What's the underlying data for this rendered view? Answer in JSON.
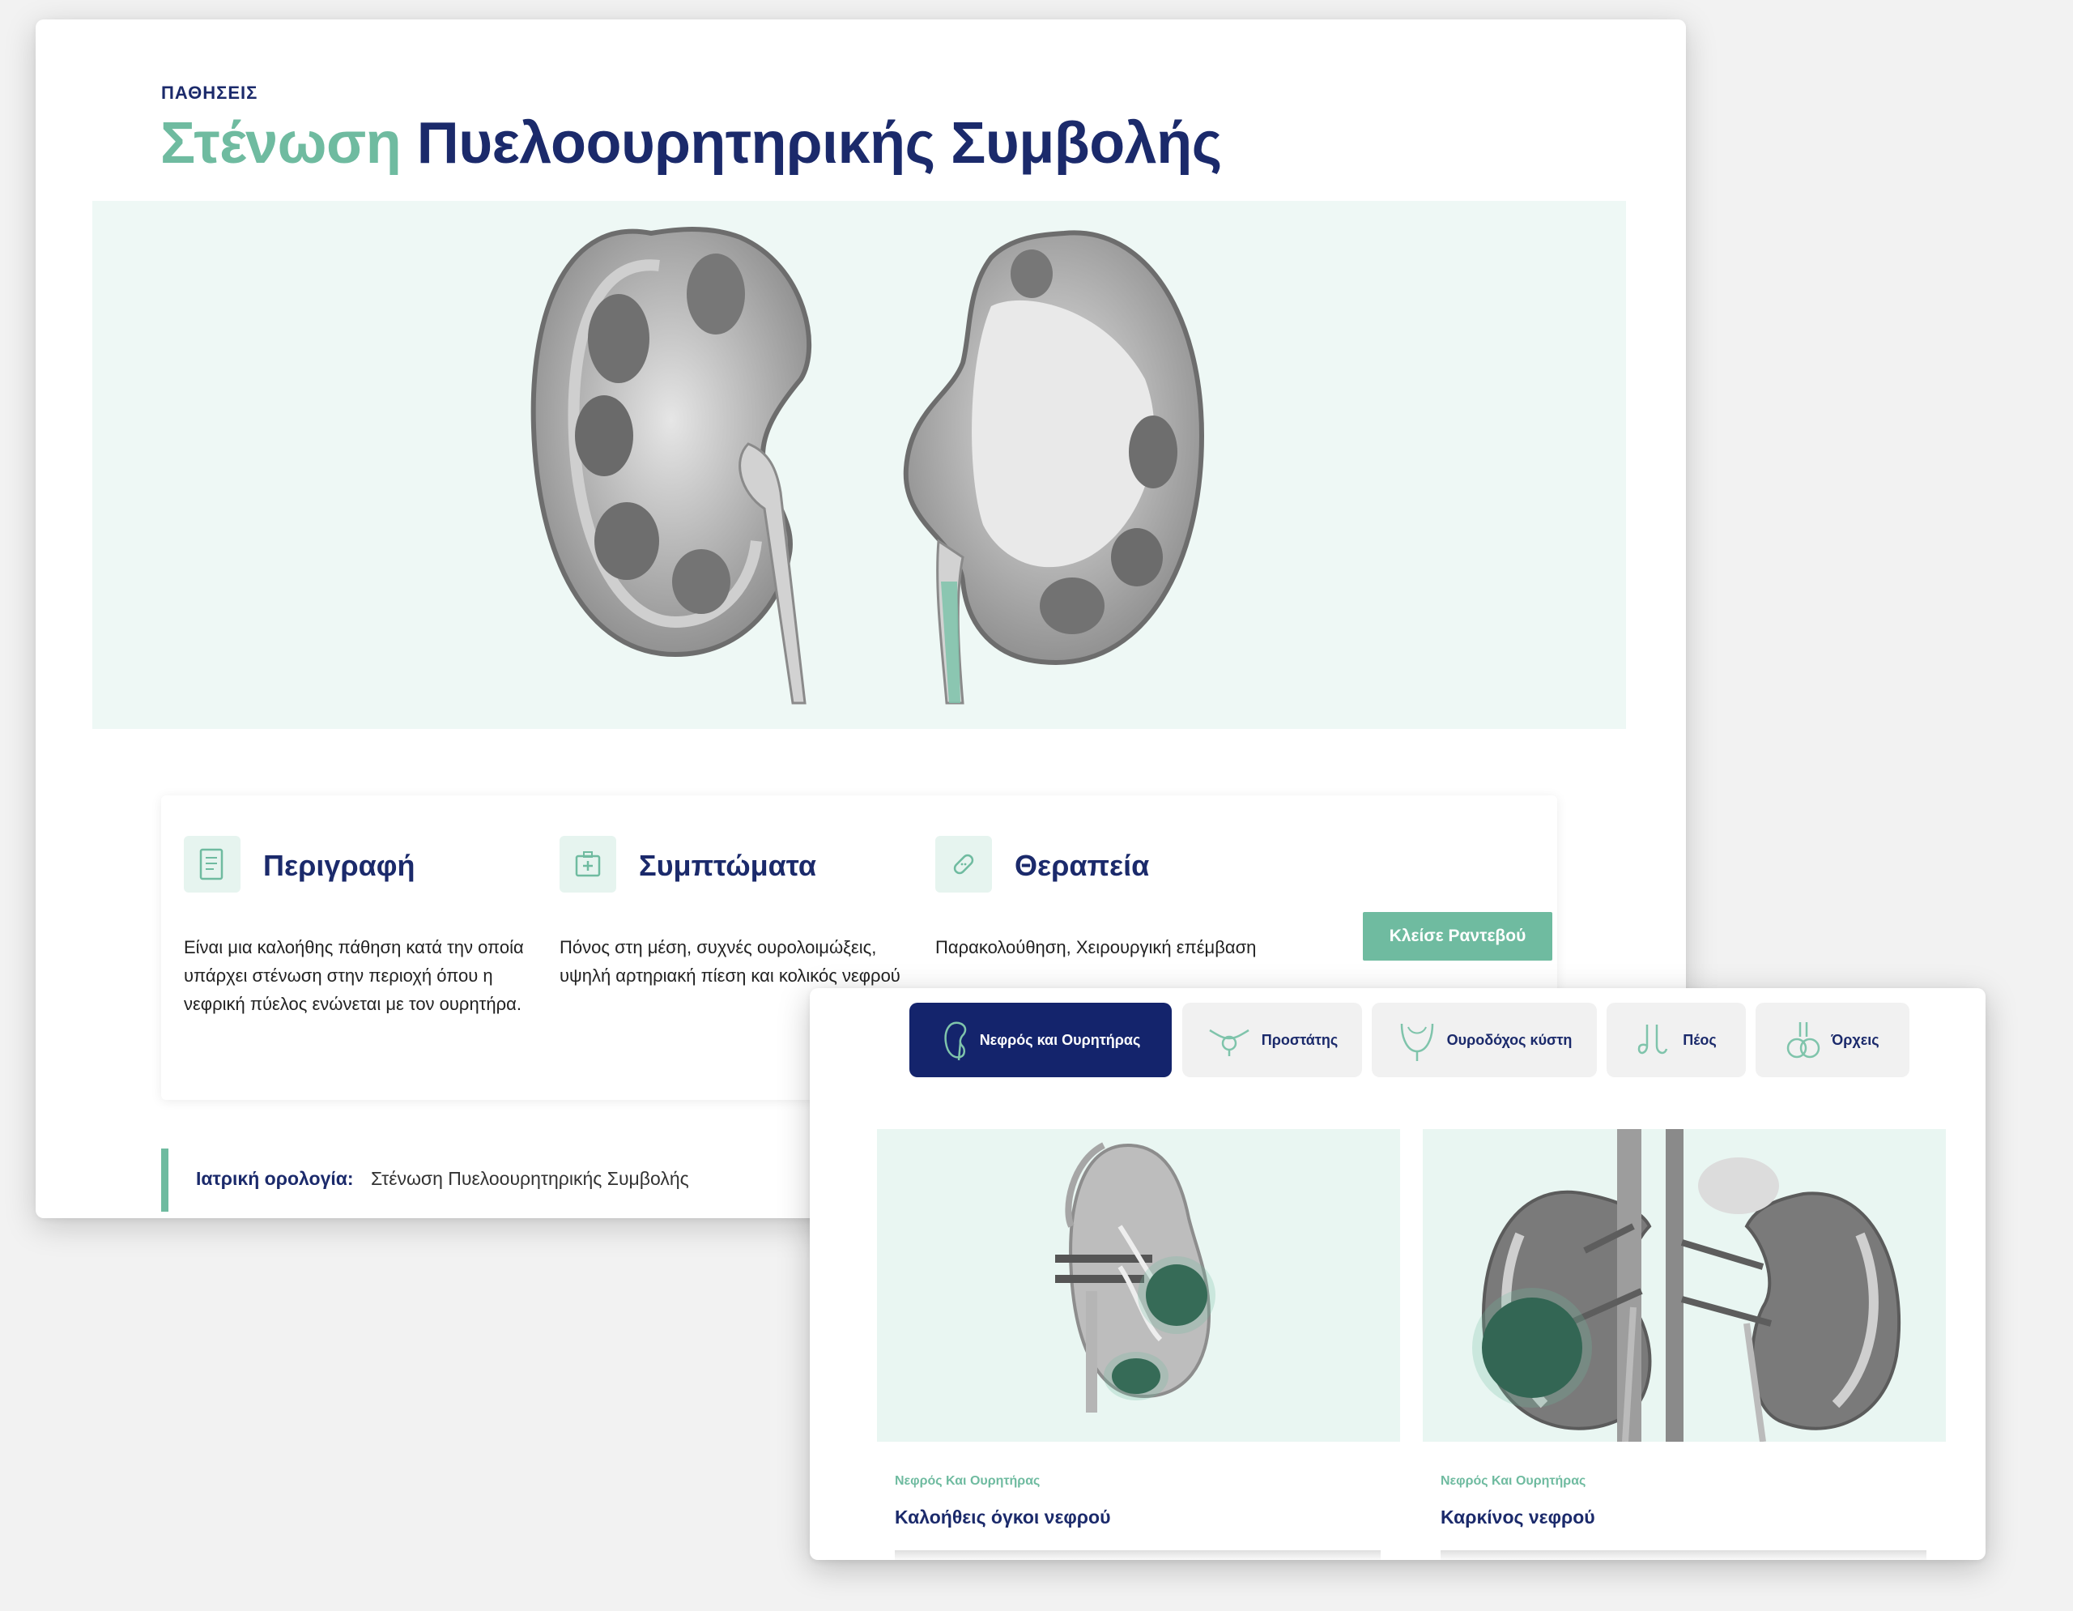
{
  "page": {
    "eyebrow": "ΠΑΘΗΣΕΙΣ",
    "title_accent": "Στένωση",
    "title_rest": "Πυελοουρητηρικής Συμβολής"
  },
  "info": {
    "description": {
      "heading": "Περιγραφή",
      "icon": "document-icon",
      "text": "Είναι μια καλοήθης πάθηση κατά την οποία υπάρχει στένωση στην περιοχή όπου η νεφρική πύελος ενώνεται με τον ουρητήρα."
    },
    "symptoms": {
      "heading": "Συμπτώματα",
      "icon": "medical-kit-icon",
      "text": "Πόνος στη μέση, συχνές ουρολοιμώξεις, υψηλή αρτηριακή πίεση και κολικός νεφρού"
    },
    "treatment": {
      "heading": "Θεραπεία",
      "icon": "bandage-icon",
      "text": "Παρακολούθηση, Χειρουργική επέμβαση"
    },
    "book_button": "Κλείσε Ραντεβού"
  },
  "terminology": {
    "label": "Ιατρική ορολογία:",
    "value": "Στένωση Πυελοουρητηρικής Συμβολής"
  },
  "categories": {
    "active_index": 0,
    "tabs": [
      {
        "label": "Νεφρός και Ουρητήρας",
        "icon": "kidney-icon"
      },
      {
        "label": "Προστάτης",
        "icon": "prostate-icon"
      },
      {
        "label": "Ουροδόχος κύστη",
        "icon": "bladder-icon"
      },
      {
        "label": "Πέος",
        "icon": "penis-icon"
      },
      {
        "label": "Όρχεις",
        "icon": "testes-icon"
      }
    ]
  },
  "articles": [
    {
      "category": "Νεφρός Και Ουρητήρας",
      "title": "Καλοήθεις όγκοι νεφρού"
    },
    {
      "category": "Νεφρός Και Ουρητήρας",
      "title": "Καρκίνος νεφρού"
    }
  ],
  "colors": {
    "navy": "#1b2a6b",
    "accent_green": "#6fbba0",
    "hero_bg": "#eef8f5",
    "active_tab": "#14246c"
  }
}
